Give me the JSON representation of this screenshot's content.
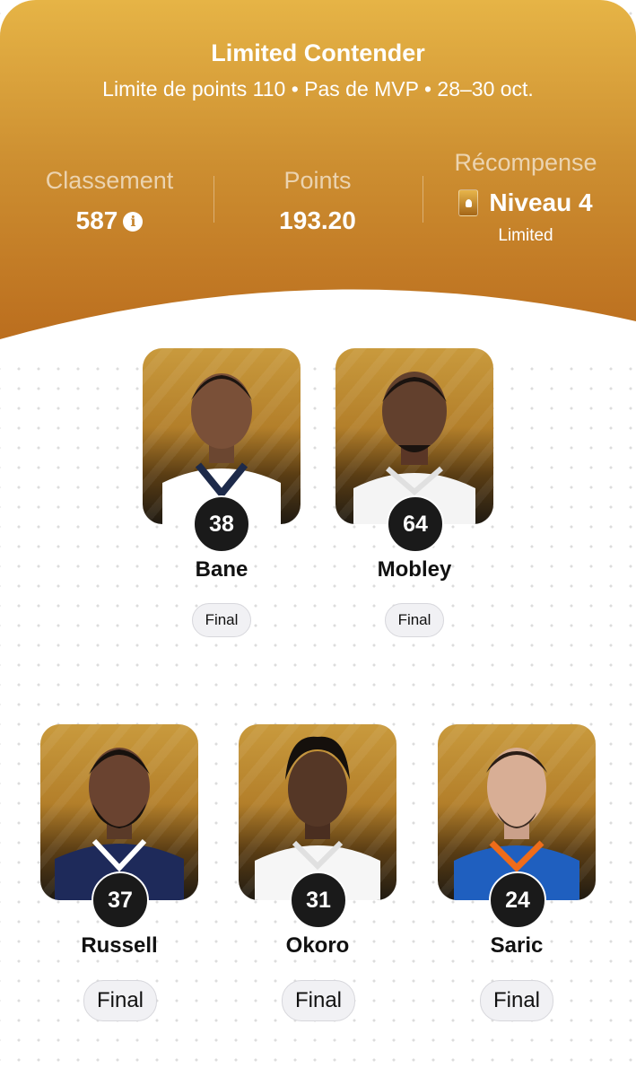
{
  "contest": {
    "title": "Limited Contender",
    "subtitle": "Limite de points 110 • Pas de MVP • 28–30 oct."
  },
  "stats": {
    "rank_label": "Classement",
    "rank_value": "587",
    "points_label": "Points",
    "points_value": "193.20",
    "reward_label": "Récompense",
    "reward_value": "Niveau 4",
    "reward_sub": "Limited"
  },
  "players": [
    {
      "name": "Bane",
      "score": "38",
      "status": "Final",
      "jersey": "#ffffff",
      "trim": "#1d2a4a"
    },
    {
      "name": "Mobley",
      "score": "64",
      "status": "Final",
      "jersey": "#f4f4f4",
      "trim": "#e0e0e0"
    },
    {
      "name": "Russell",
      "score": "37",
      "status": "Final",
      "jersey": "#1e2a5a",
      "trim": "#ffffff"
    },
    {
      "name": "Okoro",
      "score": "31",
      "status": "Final",
      "jersey": "#f6f6f6",
      "trim": "#e0e0e0"
    },
    {
      "name": "Saric",
      "score": "24",
      "status": "Final",
      "jersey": "#1f5fbf",
      "trim": "#ef6c1a"
    }
  ],
  "icons": {
    "info": "info-icon",
    "reward_badge": "card-badge-icon"
  }
}
